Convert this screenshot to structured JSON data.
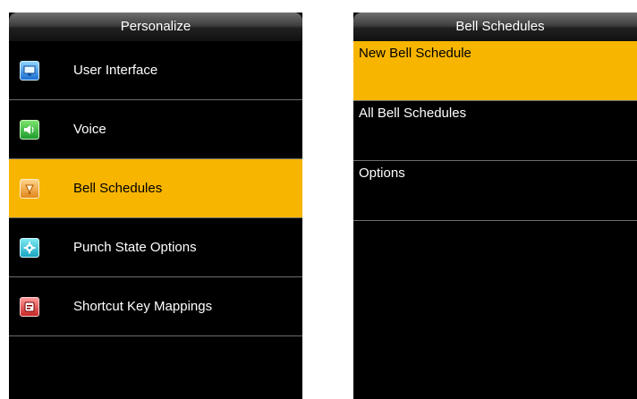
{
  "left": {
    "title": "Personalize",
    "items": [
      {
        "label": "User Interface",
        "icon": "monitor-icon"
      },
      {
        "label": "Voice",
        "icon": "speaker-icon"
      },
      {
        "label": "Bell Schedules",
        "icon": "bell-icon",
        "selected": true
      },
      {
        "label": "Punch State Options",
        "icon": "gear-icon"
      },
      {
        "label": "Shortcut Key Mappings",
        "icon": "keyboard-key-icon"
      }
    ]
  },
  "right": {
    "title": "Bell Schedules",
    "items": [
      {
        "label": "New Bell Schedule",
        "selected": true
      },
      {
        "label": "All Bell Schedules"
      },
      {
        "label": "Options"
      }
    ]
  },
  "colors": {
    "highlight": "#f7b500",
    "background": "#000000",
    "separator": "#6d6d6d"
  }
}
